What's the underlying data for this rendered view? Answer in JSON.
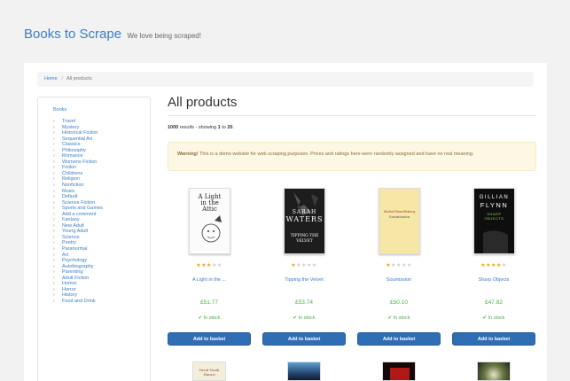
{
  "header": {
    "brand": "Books to Scrape",
    "tagline": "We love being scraped!"
  },
  "breadcrumb": {
    "home": "Home",
    "separator": "/",
    "current": "All products"
  },
  "sidebar": {
    "heading": "Books",
    "categories": [
      "Travel",
      "Mystery",
      "Historical Fiction",
      "Sequential Art",
      "Classics",
      "Philosophy",
      "Romance",
      "Womens Fiction",
      "Fiction",
      "Childrens",
      "Religion",
      "Nonfiction",
      "Music",
      "Default",
      "Science Fiction",
      "Sports and Games",
      "Add a comment",
      "Fantasy",
      "New Adult",
      "Young Adult",
      "Science",
      "Poetry",
      "Paranormal",
      "Art",
      "Psychology",
      "Autobiography",
      "Parenting",
      "Adult Fiction",
      "Humor",
      "Horror",
      "History",
      "Food and Drink"
    ]
  },
  "main": {
    "title": "All products",
    "results": {
      "count": "1000",
      "text": "results - showing",
      "from": "1",
      "to_word": "to",
      "to": "20",
      "end": "."
    },
    "alert": {
      "strong": "Warning!",
      "text": "This is a demo website for web scraping purposes. Prices and ratings here were randomly assigned and have no real meaning."
    }
  },
  "products": [
    {
      "title": "A Light in the ...",
      "rating": 3,
      "price": "£51.77",
      "stock": "In stock",
      "button": "Add to basket",
      "cover": {
        "line1": "A Light",
        "line2": "in the",
        "line3": "Attic"
      }
    },
    {
      "title": "Tipping the Velvet",
      "rating": 1,
      "price": "£53.74",
      "stock": "In stock",
      "button": "Add to basket",
      "cover": {
        "line1": "SARAH",
        "line2": "WATERS",
        "line3": "TIPPING THE VELVET"
      }
    },
    {
      "title": "Soumission",
      "rating": 1,
      "price": "£50.10",
      "stock": "In stock",
      "button": "Add to basket",
      "cover": {
        "line1": "Michel Houellebecq",
        "line2": "Soumission"
      }
    },
    {
      "title": "Sharp Objects",
      "rating": 4,
      "price": "£47.82",
      "stock": "In stock",
      "button": "Add to basket",
      "cover": {
        "line1": "GILLIAN",
        "line2": "FLYNN",
        "line3": "SHARP OBJECTS"
      }
    }
  ],
  "next_row_covers": [
    {
      "text": "Yuval Noah Harari"
    }
  ],
  "icons": {
    "check": "check-icon",
    "star": "star-icon",
    "bullet": "bullet-icon"
  },
  "colors": {
    "link": "#3a7dc8",
    "price": "#4cae4c",
    "button": "#2f6db5",
    "star": "#e6a817",
    "alert_bg": "#fcf8e3"
  }
}
